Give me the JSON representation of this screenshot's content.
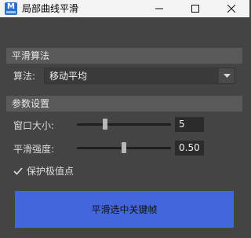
{
  "window": {
    "title": "局部曲线平滑",
    "app_icon": "maya-app-icon",
    "app_icon_letter": "M"
  },
  "smooth_section": {
    "header": "平滑算法",
    "algorithm_label": "算法:",
    "algorithm_value": "移动平均"
  },
  "params_section": {
    "header": "参数设置",
    "window_size": {
      "label": "窗口大小:",
      "value": "5",
      "level": 0.3
    },
    "strength": {
      "label": "平滑强度:",
      "value": "0.50",
      "level": 0.5
    }
  },
  "preserve_extrema": {
    "label": "保护极值点",
    "checked": true
  },
  "action": {
    "label": "平滑选中关键帧"
  },
  "colors": {
    "background": "#444444",
    "section_header": "#595959",
    "button": "#4466dd",
    "titlebar": "#f3f3f3"
  }
}
